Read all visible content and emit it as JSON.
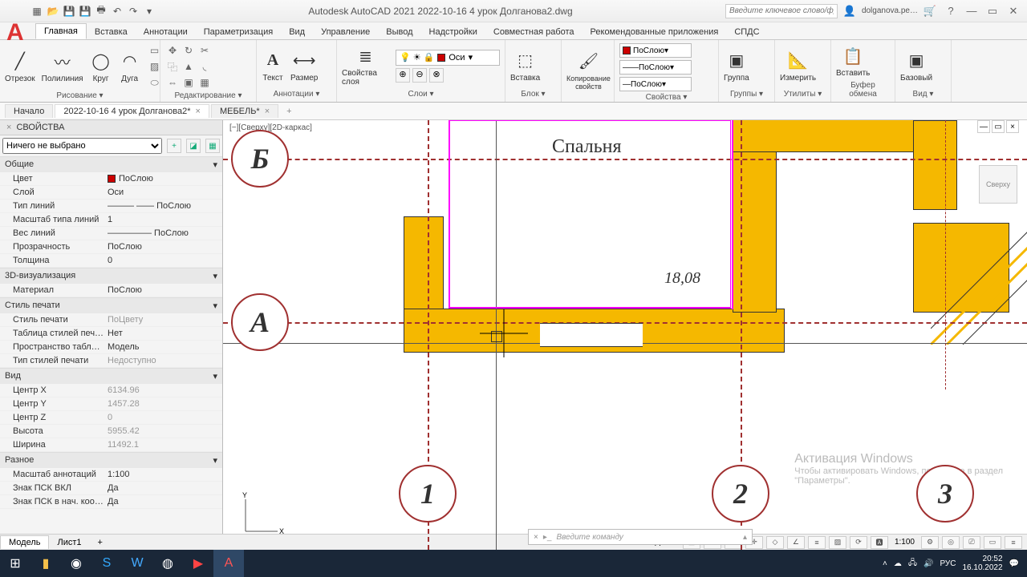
{
  "title": "Autodesk AutoCAD 2021   2022-10-16 4 урок Долганова2.dwg",
  "search_placeholder": "Введите ключевое слово/фразу",
  "user": "dolganova.pe…",
  "ribbon_tabs": [
    "Главная",
    "Вставка",
    "Аннотации",
    "Параметризация",
    "Вид",
    "Управление",
    "Вывод",
    "Надстройки",
    "Совместная работа",
    "Рекомендованные приложения",
    "СПДС"
  ],
  "panels": {
    "draw": {
      "label": "Рисование ▾",
      "items": [
        "Отрезок",
        "Полилиния",
        "Круг",
        "Дуга"
      ]
    },
    "modify": {
      "label": "Редактирование ▾"
    },
    "annot": {
      "label": "Аннотации ▾",
      "items": [
        "Текст",
        "Размер"
      ]
    },
    "layers": {
      "label": "Слои ▾",
      "current": "Оси",
      "btn": "Свойства слоя"
    },
    "block": {
      "label": "Блок ▾",
      "btn": "Вставка"
    },
    "clip": {
      "label": "",
      "btn": "Копирование свойств"
    },
    "props": {
      "label": "Свойства ▾",
      "bylayer": "ПоСлою"
    },
    "groups": {
      "label": "Группы ▾",
      "btn": "Группа"
    },
    "utils": {
      "label": "Утилиты ▾",
      "btn": "Измерить"
    },
    "clipboard": {
      "label": "Буфер обмена",
      "btn": "Вставить"
    },
    "view": {
      "label": "Вид ▾",
      "btn": "Базовый"
    }
  },
  "filetabs": [
    {
      "label": "Начало"
    },
    {
      "label": "2022-10-16 4 урок Долганова2*",
      "active": true
    },
    {
      "label": "МЕБЕЛЬ*"
    }
  ],
  "viewport_tag": "[−][Сверху][2D-каркас]",
  "room_label": "Спальня",
  "dimension": "18,08",
  "grid_bubbles": {
    "A": "А",
    "B": "Б",
    "n1": "1",
    "n2": "2",
    "n3": "3"
  },
  "props_panel": {
    "title": "СВОЙСТВА",
    "selection": "Ничего не выбрано",
    "groups": [
      {
        "name": "Общие",
        "rows": [
          {
            "l": "Цвет",
            "v": "ПоСлою",
            "swatch": true
          },
          {
            "l": "Слой",
            "v": "Оси"
          },
          {
            "l": "Тип линий",
            "v": "——— —— ПоСлою"
          },
          {
            "l": "Масштаб типа линий",
            "v": "1"
          },
          {
            "l": "Вес линий",
            "v": "————— ПоСлою"
          },
          {
            "l": "Прозрачность",
            "v": "ПоСлою"
          },
          {
            "l": "Толщина",
            "v": "0"
          }
        ]
      },
      {
        "name": "3D-визуализация",
        "rows": [
          {
            "l": "Материал",
            "v": "ПоСлою"
          }
        ]
      },
      {
        "name": "Стиль печати",
        "rows": [
          {
            "l": "Стиль печати",
            "v": "ПоЦвету",
            "grey": true
          },
          {
            "l": "Таблица стилей печ…",
            "v": "Нет"
          },
          {
            "l": "Пространство табл…",
            "v": "Модель"
          },
          {
            "l": "Тип стилей печати",
            "v": "Недоступно",
            "grey": true
          }
        ]
      },
      {
        "name": "Вид",
        "rows": [
          {
            "l": "Центр X",
            "v": "6134.96",
            "grey": true
          },
          {
            "l": "Центр Y",
            "v": "1457.28",
            "grey": true
          },
          {
            "l": "Центр Z",
            "v": "0",
            "grey": true
          },
          {
            "l": "Высота",
            "v": "5955.42",
            "grey": true
          },
          {
            "l": "Ширина",
            "v": "11492.1",
            "grey": true
          }
        ]
      },
      {
        "name": "Разное",
        "rows": [
          {
            "l": "Масштаб аннотаций",
            "v": "1:100"
          },
          {
            "l": "Знак ПСК ВКЛ",
            "v": "Да"
          },
          {
            "l": "Знак ПСК в нач. коо…",
            "v": "Да"
          }
        ]
      }
    ]
  },
  "model_tabs": [
    "Модель",
    "Лист1"
  ],
  "status": {
    "model": "МОДЕЛЬ",
    "scale": "1:100"
  },
  "cmd_placeholder": "Введите команду",
  "watermark": {
    "l1": "Активация Windows",
    "l2": "Чтобы активировать Windows, перейдите в раздел",
    "l3": "\"Параметры\"."
  },
  "viewcube": "Сверху",
  "clock": {
    "time": "20:52",
    "date": "16.10.2022"
  },
  "lang": "РУС"
}
